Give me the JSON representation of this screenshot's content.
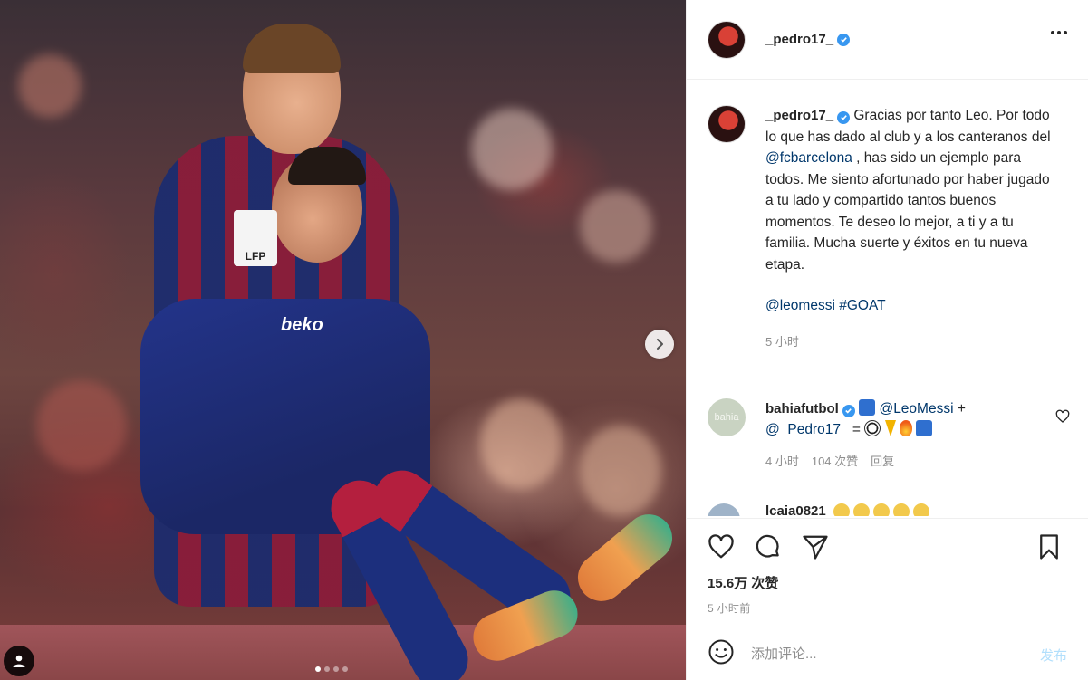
{
  "photo": {
    "badge_lfp": "LFP",
    "badge_beko": "beko",
    "slide_count": 4,
    "active_slide": 1
  },
  "header": {
    "username": "_pedro17_",
    "verified": true
  },
  "caption": {
    "username": "_pedro17_",
    "text_before_mention": "Gracias por tanto Leo. Por todo lo que has dado al club y a los canteranos del ",
    "mention_club": "@fcbarcelona",
    "text_after_mention": " , has sido un ejemplo para todos. Me siento afortunado por haber jugado a tu lado y compartido tantos buenos momentos. Te deseo lo mejor, a ti y a tu familia. Mucha suerte y éxitos en tu nueva etapa.",
    "mention_player": "@leomessi",
    "hashtag": "#GOAT",
    "time": "5 小时"
  },
  "comments": [
    {
      "username": "bahiafutbol",
      "avatar_text": "bahia",
      "mention_1": "@LeoMessi",
      "joiner": " + ",
      "mention_2": "@_Pedro17_",
      "equals": " = ",
      "time": "4 小时",
      "likes": "104 次赞",
      "reply": "回复"
    }
  ],
  "partial_comment": {
    "username": "lcaia0821"
  },
  "actions": {
    "likes_count": "15.6万 次赞",
    "posted_time": "5 小时前"
  },
  "comment_box": {
    "placeholder": "添加评论...",
    "post_label": "发布"
  },
  "colors": {
    "link": "#00376b",
    "verified": "#3897f0",
    "muted": "#8e8e8e",
    "post_disabled": "#b2dffc"
  }
}
